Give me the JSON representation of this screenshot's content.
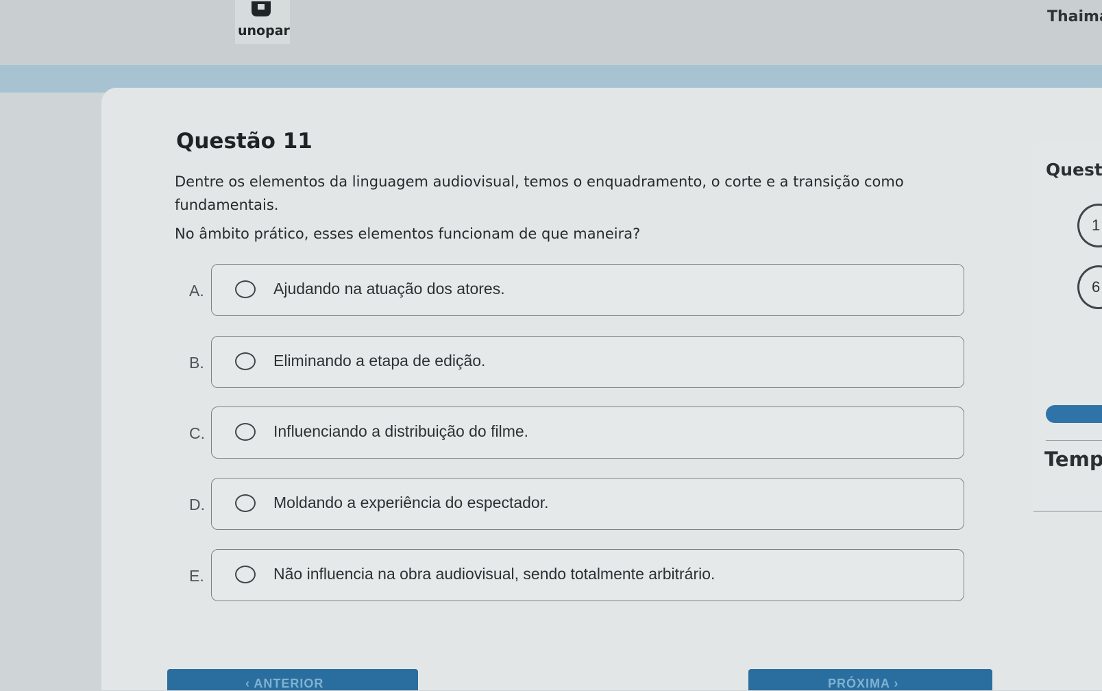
{
  "header": {
    "logo_text": "unopar",
    "user_name": "Thaima"
  },
  "question": {
    "title": "Questão 11",
    "text_line1": "Dentre os elementos da linguagem audiovisual, temos o enquadramento, o corte e a transição como",
    "text_line2": "fundamentais.",
    "text_line3": "No âmbito prático, esses elementos funcionam de que maneira?"
  },
  "options": [
    {
      "letter": "A.",
      "text": "Ajudando na atuação dos atores."
    },
    {
      "letter": "B.",
      "text": "Eliminando a etapa de edição."
    },
    {
      "letter": "C.",
      "text": "Influenciando a distribuição do filme."
    },
    {
      "letter": "D.",
      "text": "Moldando a experiência do espectador."
    },
    {
      "letter": "E.",
      "text": "Não influencia na obra audiovisual, sendo totalmente arbitrário."
    }
  ],
  "side_panel": {
    "title": "Questõ",
    "circle_1": "1",
    "circle_2": "6",
    "time_label": "Temp"
  },
  "nav": {
    "prev_label": "‹ ANTERIOR",
    "next_label": "PRÓXIMA ›"
  },
  "colors": {
    "accent": "#2f73a8",
    "band": "#a7c3d1"
  }
}
